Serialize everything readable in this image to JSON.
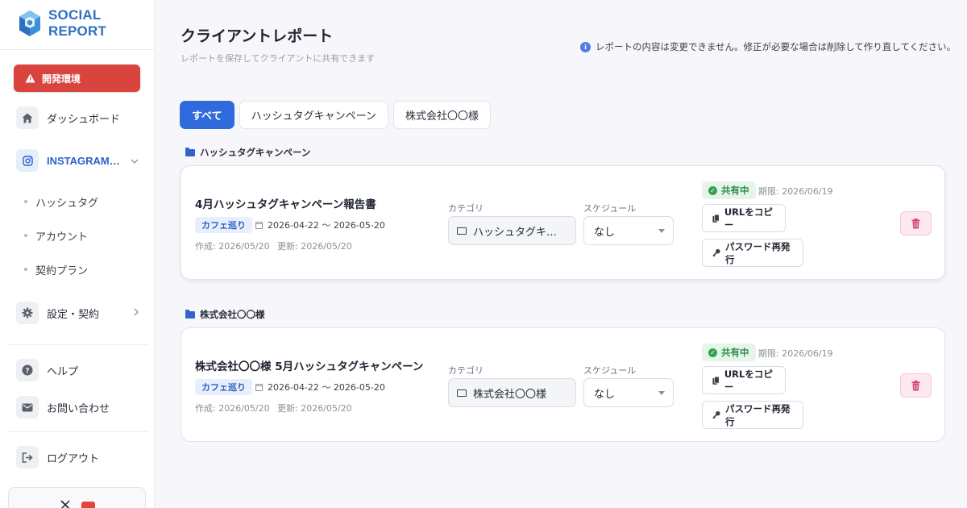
{
  "app": {
    "logo_text": "SOCIAL REPORT"
  },
  "sidebar": {
    "env_badge": "開発環境",
    "nav": [
      {
        "label": "ダッシュボード",
        "icon": "home-icon"
      },
      {
        "label": "INSTAGRAM…",
        "icon": "instagram-icon"
      },
      {
        "label": "設定・契約",
        "icon": "gear-icon"
      },
      {
        "label": "ヘルプ",
        "icon": "help-icon"
      },
      {
        "label": "お問い合わせ",
        "icon": "mail-icon"
      },
      {
        "label": "ログアウト",
        "icon": "logout-icon"
      }
    ],
    "sub_items": [
      "ハッシュタグ",
      "アカウント",
      "契約プラン"
    ]
  },
  "header": {
    "title": "クライアントレポート",
    "subtitle": "レポートを保存してクライアントに共有できます",
    "notice": "レポートの内容は変更できません。修正が必要な場合は削除して作り直してください。"
  },
  "tabs": [
    "すべて",
    "ハッシュタグキャンペーン",
    "株式会社〇〇様"
  ],
  "groups": [
    {
      "label": "ハッシュタグキャンペーン",
      "report": {
        "title": "4月ハッシュタグキャンペーン報告書",
        "tag": "カフェ巡り",
        "period": "2026-04-22 〜 2026-05-20",
        "created": "作成: 2026/05/20",
        "updated": "更新: 2026/05/20",
        "category_label": "カテゴリ",
        "category_value": "ハッシュタグキ…",
        "schedule_label": "スケジュール",
        "schedule_value": "なし",
        "share_status": "共有中",
        "expiry": "期限: 2026/06/19",
        "copy_url": "URLをコピー",
        "reissue_password": "パスワード再発行"
      }
    },
    {
      "label": "株式会社〇〇様",
      "report": {
        "title": "株式会社〇〇様 5月ハッシュタグキャンペーン",
        "tag": "カフェ巡り",
        "period": "2026-04-22 〜 2026-05-20",
        "created": "作成: 2026/05/20",
        "updated": "更新: 2026/05/20",
        "category_label": "カテゴリ",
        "category_value": "株式会社〇〇様",
        "schedule_label": "スケジュール",
        "schedule_value": "なし",
        "share_status": "共有中",
        "expiry": "期限: 2026/06/19",
        "copy_url": "URLをコピー",
        "reissue_password": "パスワード再発行"
      }
    }
  ],
  "colors": {
    "accent": "#2f6bdc",
    "danger": "#d9443f",
    "success": "#2e8c49",
    "brand": "#2f6fc1"
  }
}
